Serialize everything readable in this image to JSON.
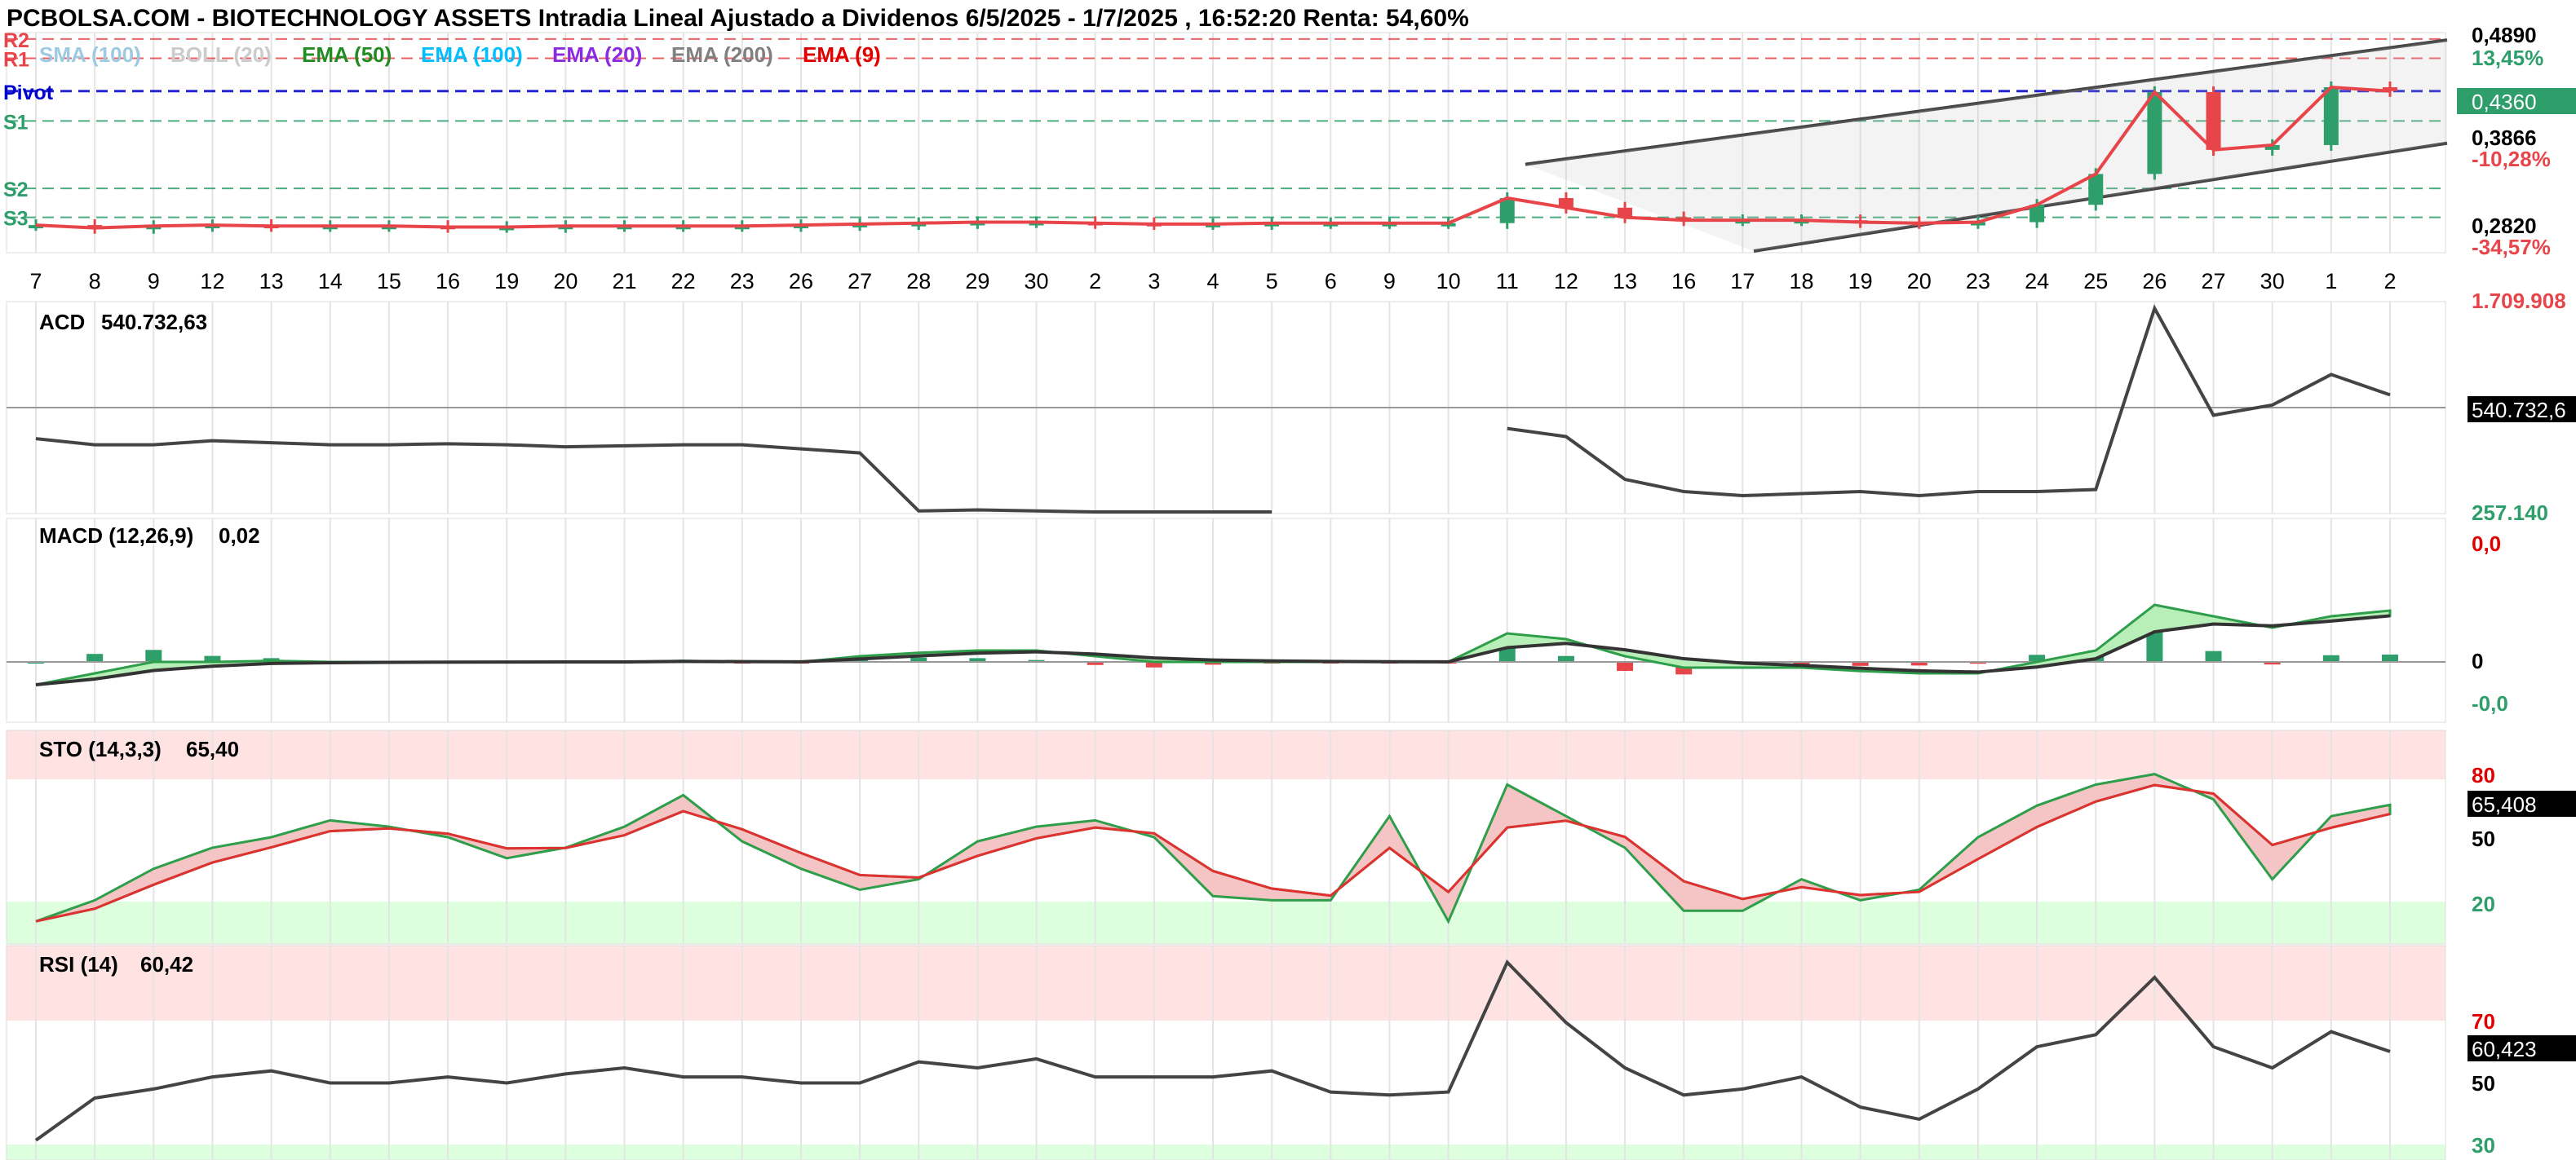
{
  "header": {
    "title": "PCBOLSA.COM - BIOTECHNOLOGY ASSETS Intradia Lineal Ajustado a Dividenos 6/5/2025 - 1/7/2025 , 16:52:20 Renta: 54,60%"
  },
  "legend": [
    {
      "label": "SMA (100)",
      "color": "#9ecae1"
    },
    {
      "label": "BOLL (20)",
      "color": "#cccccc"
    },
    {
      "label": "EMA (50)",
      "color": "#228b22"
    },
    {
      "label": "EMA (100)",
      "color": "#00bfff"
    },
    {
      "label": "EMA (20)",
      "color": "#8a2be2"
    },
    {
      "label": "EMA (200)",
      "color": "#808080"
    },
    {
      "label": "EMA (9)",
      "color": "#e00000"
    }
  ],
  "colors": {
    "up": "#2e9e6b",
    "down": "#e8454a",
    "pivot": "#0000cc",
    "resistance": "#e8454a",
    "support": "#2e9e6b",
    "channel": "#333333",
    "price_line": "#e8454a"
  },
  "levels": [
    {
      "name": "R2",
      "value": 0.49,
      "color": "#e8454a"
    },
    {
      "name": "R1",
      "value": 0.47,
      "color": "#e8454a"
    },
    {
      "name": "Pivot",
      "value": 0.436,
      "color": "#0000cc"
    },
    {
      "name": "S1",
      "value": 0.405,
      "color": "#2e9e6b"
    },
    {
      "name": "S2",
      "value": 0.335,
      "color": "#2e9e6b"
    },
    {
      "name": "S3",
      "value": 0.305,
      "color": "#2e9e6b"
    }
  ],
  "price_axis": {
    "top": {
      "label": "0,4890",
      "value": 0.489
    },
    "pct_top": {
      "label": "13,45%"
    },
    "current": {
      "label": "0,4360",
      "value": 0.436
    },
    "mid": {
      "label": "0,3866",
      "value": 0.3866
    },
    "pct_mid": {
      "label": "-10,28%"
    },
    "low": {
      "label": "0,2820",
      "value": 0.282
    },
    "pct_low": {
      "label": "-34,57%"
    }
  },
  "x_axis": {
    "labels": [
      "7",
      "8",
      "9",
      "12",
      "13",
      "14",
      "15",
      "16",
      "19",
      "20",
      "21",
      "22",
      "23",
      "26",
      "27",
      "28",
      "29",
      "30",
      "2",
      "3",
      "4",
      "5",
      "6",
      "9",
      "10",
      "11",
      "12",
      "13",
      "16",
      "17",
      "18",
      "19",
      "20",
      "23",
      "24",
      "25",
      "26",
      "27",
      "30",
      "1",
      "2"
    ]
  },
  "panels": {
    "acd": {
      "title": "ACD",
      "value": "540.732,63",
      "tag": "540.732,6",
      "top_label": "1.709.908",
      "bottom_label": "257.140"
    },
    "macd": {
      "title": "MACD (12,26,9)",
      "value": "0,02",
      "tick_top": "0,0",
      "tick_zero": "0",
      "tick_bottom": "-0,0"
    },
    "sto": {
      "title": "STO (14,3,3)",
      "value": "65,40",
      "tag": "65,408",
      "ticks": [
        "80",
        "50",
        "20"
      ]
    },
    "rsi": {
      "title": "RSI (14)",
      "value": "60,42",
      "tag": "60,423",
      "ticks": [
        "70",
        "50",
        "30"
      ]
    }
  },
  "chart_data": {
    "type": "candlestick",
    "x": [
      "7",
      "8",
      "9",
      "12",
      "13",
      "14",
      "15",
      "16",
      "19",
      "20",
      "21",
      "22",
      "23",
      "26",
      "27",
      "28",
      "29",
      "30",
      "2",
      "3",
      "4",
      "5",
      "6",
      "9",
      "10",
      "11",
      "12",
      "13",
      "16",
      "17",
      "18",
      "19",
      "20",
      "23",
      "24",
      "25",
      "26",
      "27",
      "30",
      "1",
      "2"
    ],
    "ylim": [
      0.27,
      0.495
    ],
    "close": [
      0.297,
      0.294,
      0.296,
      0.297,
      0.296,
      0.296,
      0.296,
      0.295,
      0.295,
      0.296,
      0.296,
      0.296,
      0.296,
      0.297,
      0.298,
      0.299,
      0.3,
      0.3,
      0.299,
      0.298,
      0.298,
      0.299,
      0.299,
      0.299,
      0.299,
      0.325,
      0.315,
      0.305,
      0.302,
      0.302,
      0.302,
      0.3,
      0.299,
      0.3,
      0.318,
      0.35,
      0.435,
      0.375,
      0.38,
      0.44,
      0.436
    ],
    "acd": [
      1.12,
      1.06,
      1.06,
      1.1,
      1.08,
      1.06,
      1.06,
      1.07,
      1.06,
      1.04,
      1.05,
      1.06,
      1.06,
      1.02,
      0.98,
      0.41,
      0.42,
      0.41,
      0.4,
      0.4,
      0.4,
      0.4,
      null,
      null,
      null,
      1.22,
      1.14,
      0.72,
      0.6,
      0.56,
      0.58,
      0.6,
      0.56,
      0.6,
      0.6,
      0.62,
      2.4,
      1.35,
      1.45,
      1.75,
      1.55
    ],
    "macd": [
      -0.2,
      -0.1,
      0,
      0,
      0.01,
      0,
      0,
      0,
      0,
      0,
      0,
      0.01,
      0,
      0,
      0.05,
      0.08,
      0.1,
      0.1,
      0.05,
      0,
      0,
      0,
      0,
      0,
      0,
      0.25,
      0.2,
      0.05,
      -0.05,
      -0.05,
      -0.05,
      -0.08,
      -0.1,
      -0.1,
      0,
      0.1,
      0.5,
      0.4,
      0.3,
      0.4,
      0.45
    ],
    "sto": [
      10,
      20,
      35,
      45,
      50,
      58,
      55,
      50,
      40,
      45,
      55,
      70,
      48,
      35,
      25,
      30,
      48,
      55,
      58,
      50,
      22,
      20,
      20,
      60,
      10,
      75,
      60,
      45,
      15,
      15,
      30,
      20,
      25,
      50,
      65,
      75,
      80,
      68,
      30,
      60,
      65.4
    ],
    "rsi": [
      31,
      45,
      48,
      52,
      54,
      50,
      50,
      52,
      50,
      53,
      55,
      52,
      52,
      50,
      50,
      57,
      55,
      58,
      52,
      52,
      52,
      54,
      47,
      46,
      47,
      90,
      70,
      55,
      46,
      48,
      52,
      42,
      38,
      48,
      62,
      66,
      85,
      62,
      55,
      67,
      60.42
    ]
  }
}
